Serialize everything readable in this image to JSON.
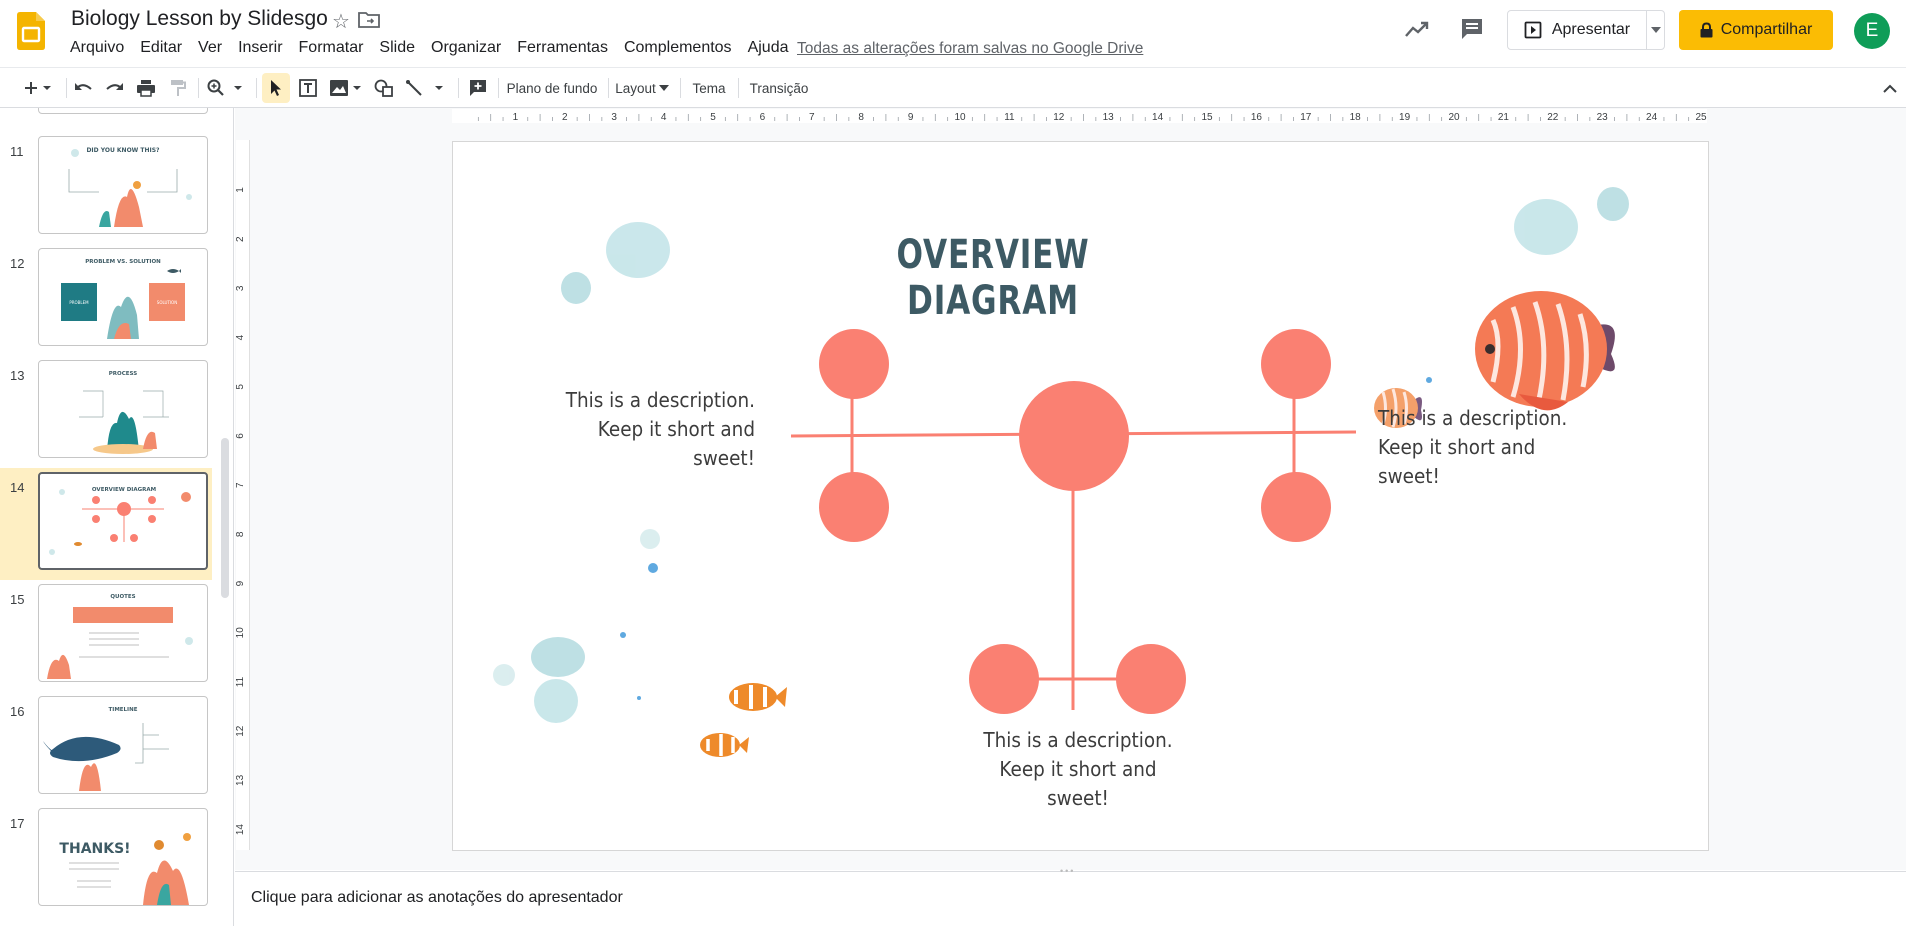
{
  "app": {
    "doc_title": "Biology Lesson by Slidesgo",
    "menu": [
      "Arquivo",
      "Editar",
      "Ver",
      "Inserir",
      "Formatar",
      "Slide",
      "Organizar",
      "Ferramentas",
      "Complementos",
      "Ajuda"
    ],
    "save_status": "Todas as alterações foram salvas no Google Drive",
    "present_label": "Apresentar",
    "share_label": "Compartilhar",
    "avatar_letter": "E",
    "brand_color": "#f4b400"
  },
  "toolbar": {
    "background_label": "Plano de fundo",
    "layout_label": "Layout",
    "theme_label": "Tema",
    "transition_label": "Transição"
  },
  "ruler": {
    "h_ticks": [
      "1",
      "2",
      "3",
      "4",
      "5",
      "6",
      "7",
      "8",
      "9",
      "10",
      "11",
      "12",
      "13",
      "14",
      "15",
      "16",
      "17",
      "18",
      "19",
      "20",
      "21",
      "22",
      "23",
      "24",
      "25"
    ],
    "v_ticks": [
      "1",
      "2",
      "3",
      "4",
      "5",
      "6",
      "7",
      "8",
      "9",
      "10",
      "11",
      "12",
      "13",
      "14"
    ]
  },
  "filmstrip": {
    "slides": [
      {
        "num": "11",
        "title": "DID YOU KNOW THIS?"
      },
      {
        "num": "12",
        "title": "PROBLEM VS. SOLUTION",
        "box_left": "PROBLEM",
        "box_right": "SOLUTION"
      },
      {
        "num": "13",
        "title": "PROCESS"
      },
      {
        "num": "14",
        "title": "OVERVIEW DIAGRAM",
        "selected": true
      },
      {
        "num": "15",
        "title": "QUOTES"
      },
      {
        "num": "16",
        "title": "TIMELINE"
      },
      {
        "num": "17",
        "title": "THANKS!"
      }
    ]
  },
  "slide": {
    "title": "OVERVIEW DIAGRAM",
    "desc_left": [
      "This is a description.",
      "Keep it short and",
      "sweet!"
    ],
    "desc_right": [
      "This is a description.",
      "Keep it short and",
      "sweet!"
    ],
    "desc_bottom": [
      "This is a description.",
      "Keep it short and",
      "sweet!"
    ],
    "accent_color": "#fa8072",
    "title_color": "#3d5a64"
  },
  "notes": {
    "placeholder": "Clique para adicionar as anotações do apresentador"
  }
}
